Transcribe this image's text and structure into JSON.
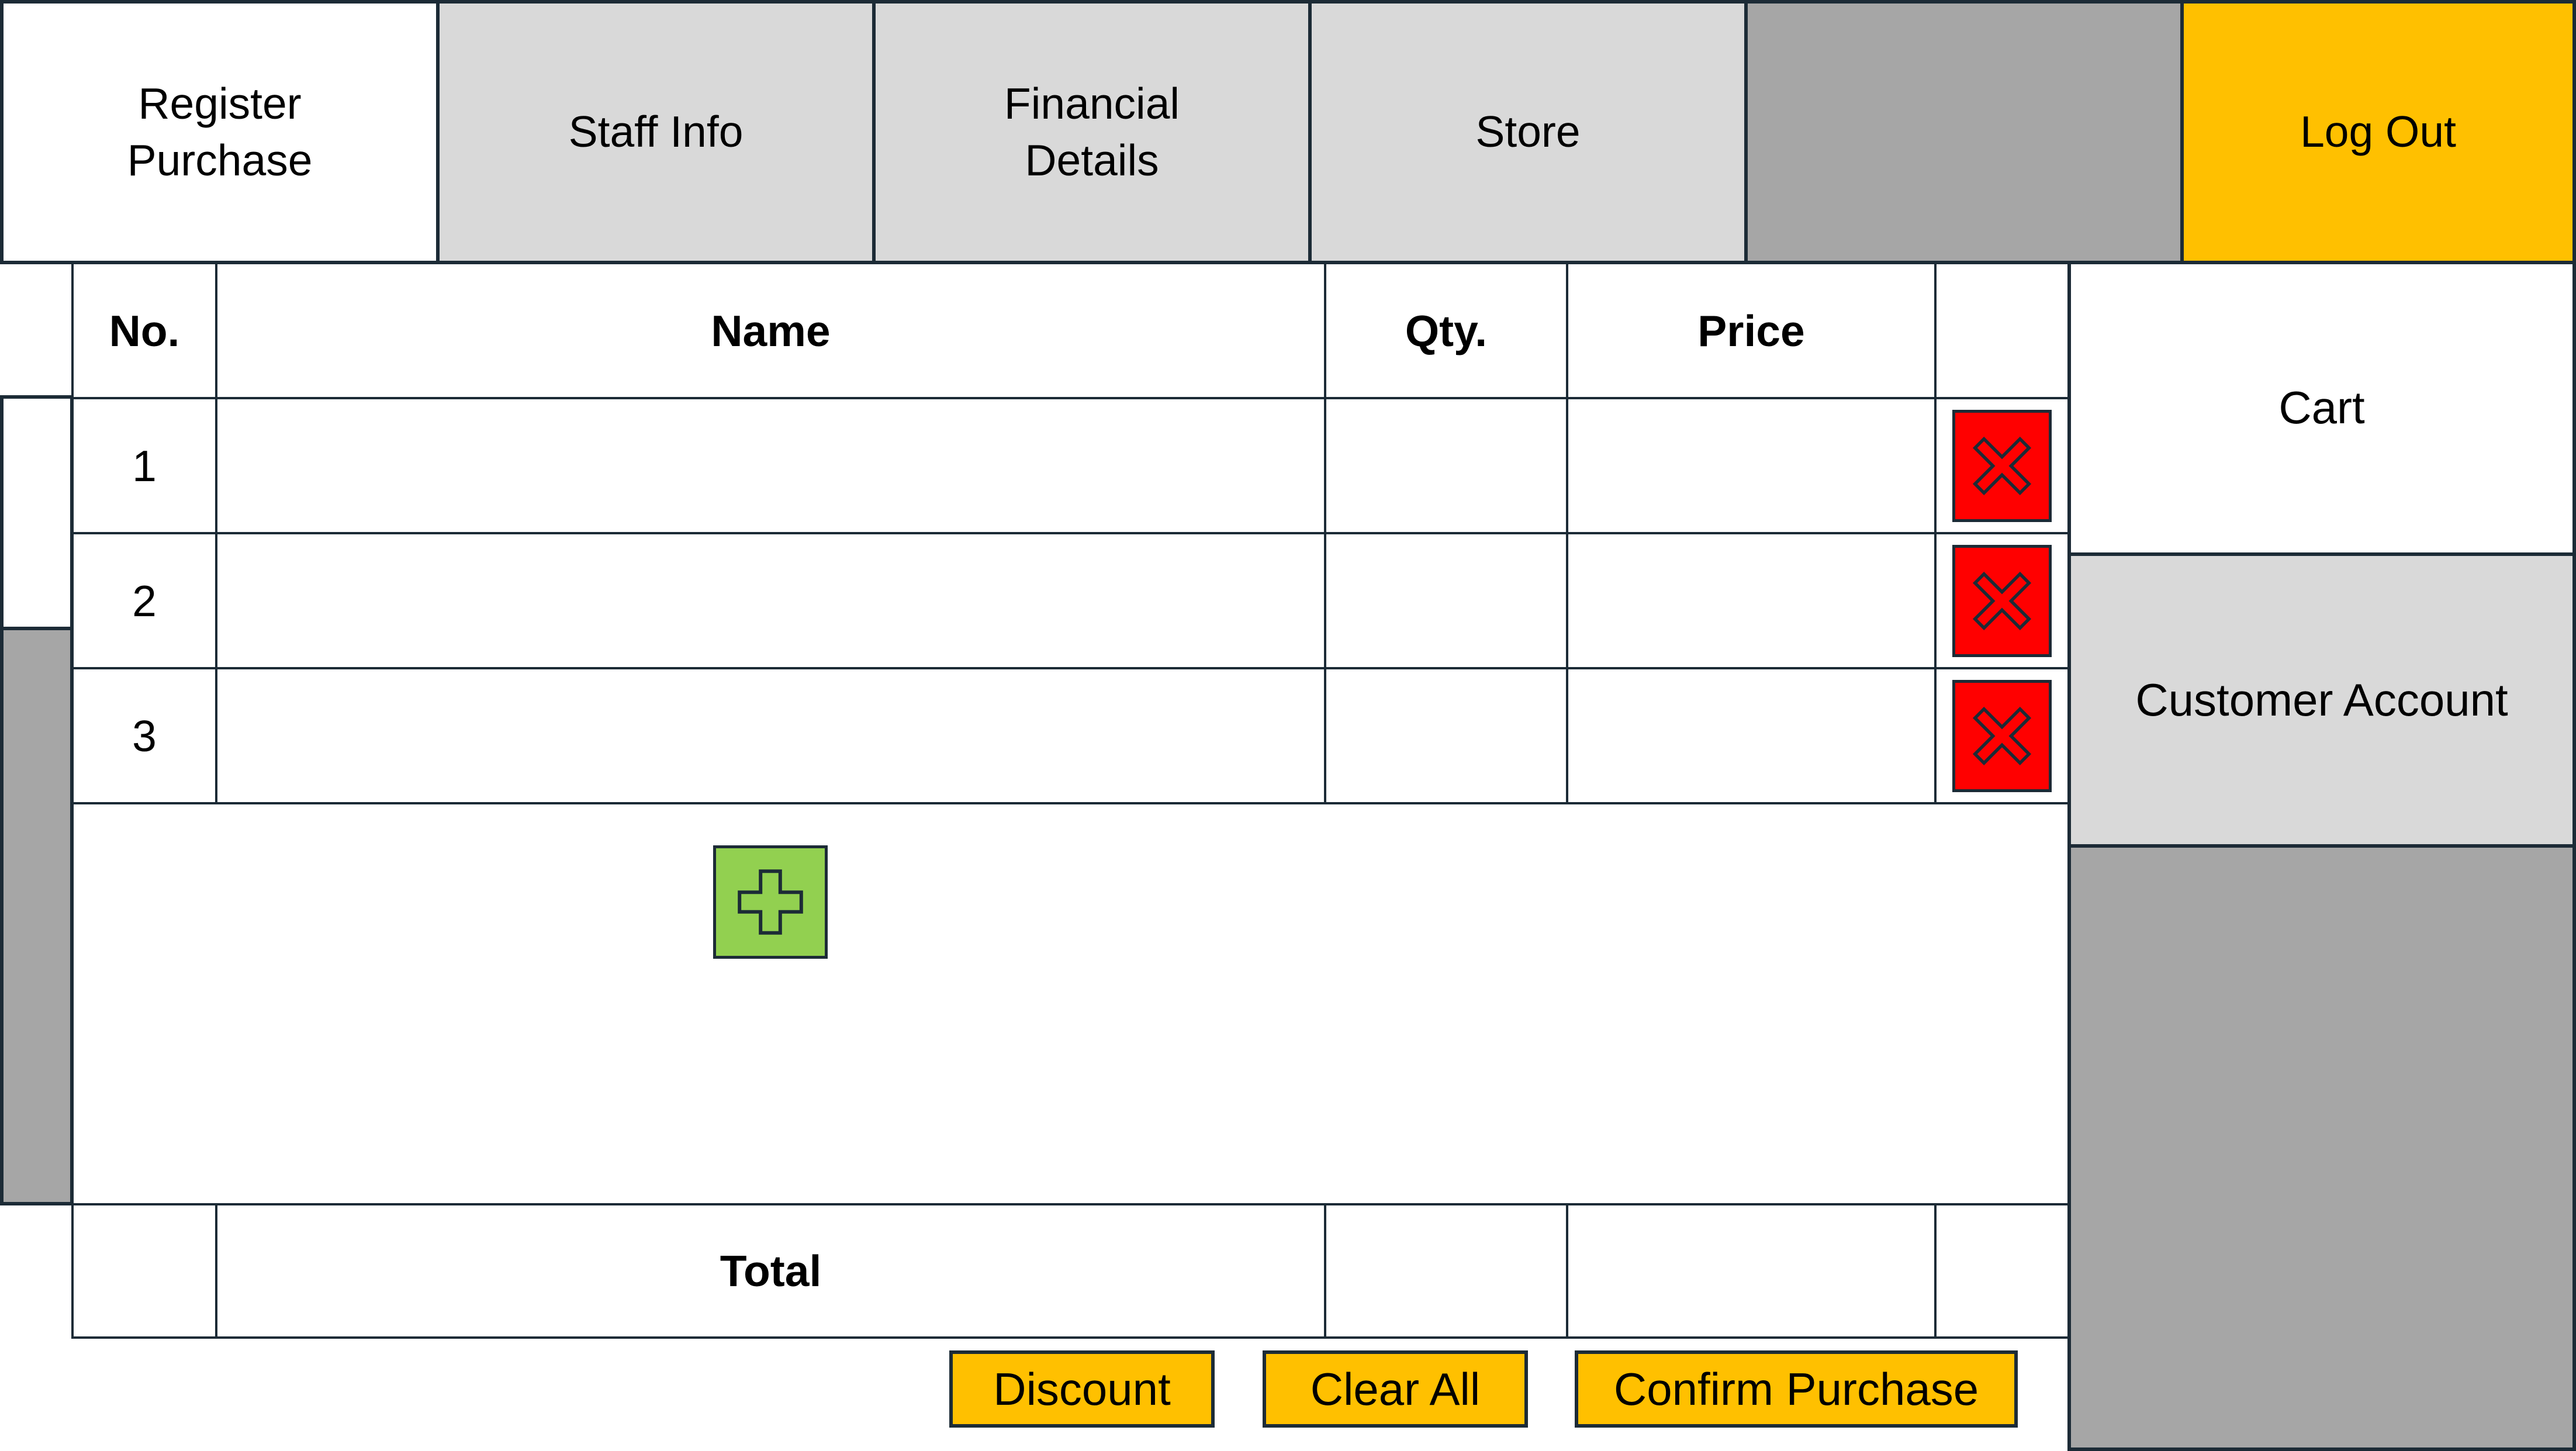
{
  "nav": {
    "tabs": [
      {
        "label": "Register Purchase"
      },
      {
        "label": "Staff Info"
      },
      {
        "label": "Financial Details"
      },
      {
        "label": "Store"
      },
      {
        "label": ""
      },
      {
        "label": "Log Out"
      }
    ]
  },
  "table": {
    "headers": [
      "No.",
      "Name",
      "Qty.",
      "Price",
      ""
    ],
    "rows": [
      {
        "no": "1",
        "name": "",
        "qty": "",
        "price": ""
      },
      {
        "no": "2",
        "name": "",
        "qty": "",
        "price": ""
      },
      {
        "no": "3",
        "name": "",
        "qty": "",
        "price": ""
      }
    ],
    "total_label": "Total"
  },
  "actions": {
    "discount": "Discount",
    "clear_all": "Clear All",
    "confirm": "Confirm Purchase"
  },
  "side": {
    "cart": "Cart",
    "customer_account": "Customer Account"
  },
  "icons": {
    "delete": "close-icon",
    "add": "plus-icon"
  },
  "colors": {
    "accent": "#ffc000",
    "delete": "#ff0000",
    "add": "#92d050",
    "inactive": "#d9d9d9",
    "disabled": "#a6a6a6",
    "border": "#1c2b36"
  }
}
